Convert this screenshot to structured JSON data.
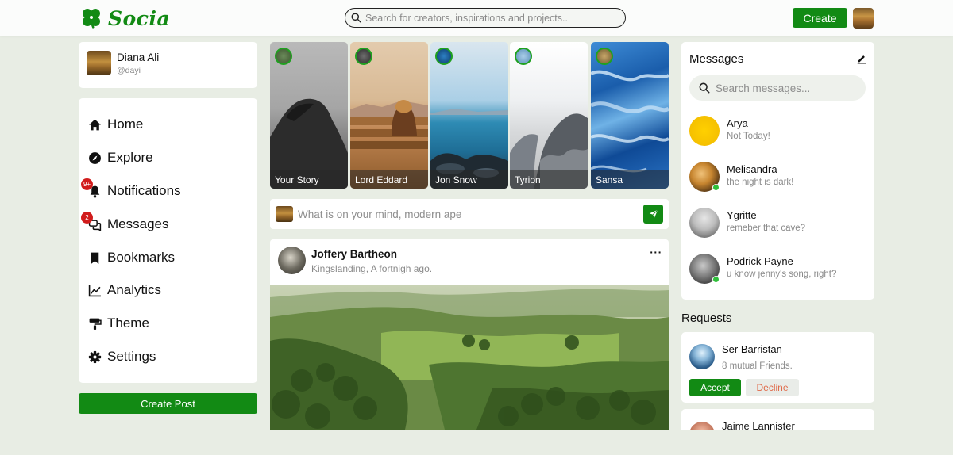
{
  "app": {
    "name": "Socia"
  },
  "nav": {
    "search_placeholder": "Search for creators, inspirations and projects..",
    "create_label": "Create"
  },
  "profile": {
    "name": "Diana Ali",
    "handle": "@dayi"
  },
  "menu": [
    {
      "label": "Home",
      "icon": "home-icon"
    },
    {
      "label": "Explore",
      "icon": "compass-icon"
    },
    {
      "label": "Notifications",
      "icon": "bell-icon",
      "badge": "9+"
    },
    {
      "label": "Messages",
      "icon": "chat-icon",
      "badge": "2"
    },
    {
      "label": "Bookmarks",
      "icon": "bookmark-icon"
    },
    {
      "label": "Analytics",
      "icon": "chart-line-icon"
    },
    {
      "label": "Theme",
      "icon": "paint-roller-icon"
    },
    {
      "label": "Settings",
      "icon": "gear-icon"
    }
  ],
  "create_post_label": "Create Post",
  "stories": [
    {
      "name": "Your Story"
    },
    {
      "name": "Lord Eddard"
    },
    {
      "name": "Jon Snow"
    },
    {
      "name": "Tyrion"
    },
    {
      "name": "Sansa"
    }
  ],
  "composer": {
    "placeholder": "What is on your mind, modern ape"
  },
  "feed": [
    {
      "author": "Joffery Bartheon",
      "meta": "Kingslanding, A fortnigh ago.",
      "more": "···"
    }
  ],
  "messages": {
    "title": "Messages",
    "search_placeholder": "Search messages...",
    "items": [
      {
        "name": "Arya",
        "text": "Not Today!",
        "online": false
      },
      {
        "name": "Melisandra",
        "text": "the night is dark!",
        "online": true
      },
      {
        "name": "Ygritte",
        "text": "remeber that cave?",
        "online": false
      },
      {
        "name": "Podrick Payne",
        "text": "u know jenny's song, right?",
        "online": true
      }
    ]
  },
  "requests": {
    "title": "Requests",
    "items": [
      {
        "name": "Ser Barristan",
        "mutual": "8 mutual Friends.",
        "accept": "Accept",
        "decline": "Decline"
      },
      {
        "name": "Jaime Lannister"
      }
    ]
  },
  "colors": {
    "brand": "#128a14",
    "background": "#e8ede4",
    "decline_text": "#e06a4a",
    "badge": "#d11c1c",
    "online": "#2fbf3a"
  }
}
